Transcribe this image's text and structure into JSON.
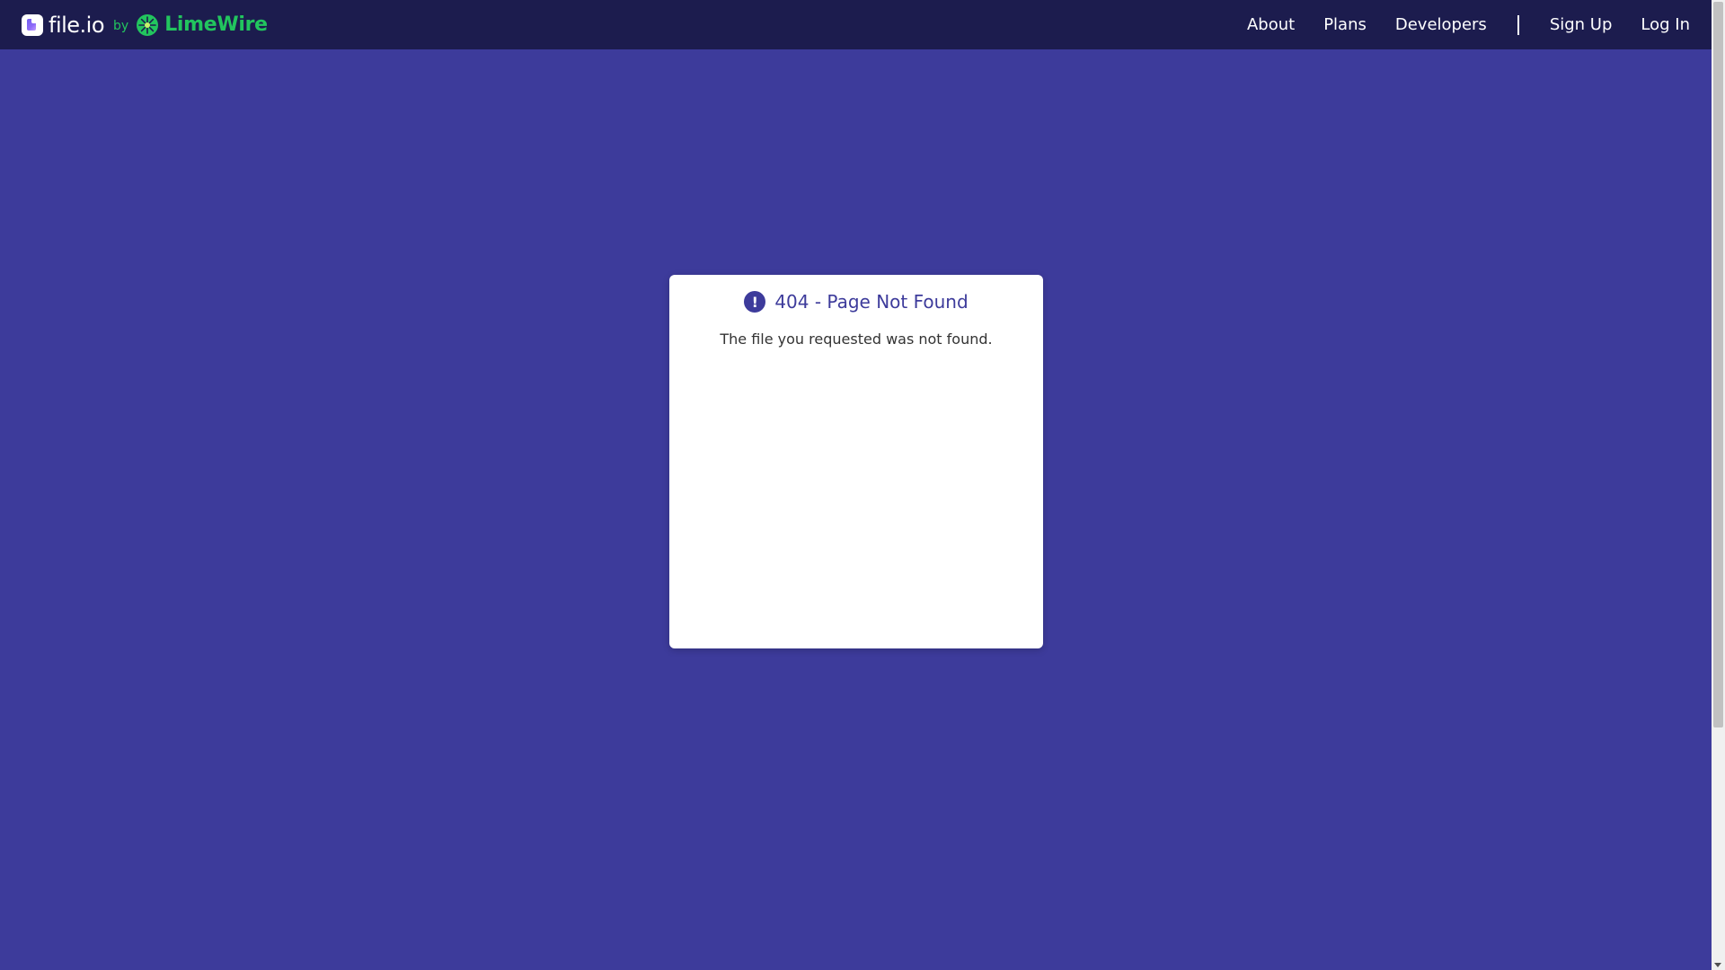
{
  "navbar": {
    "brand_name": "file.io",
    "brand_by": "by",
    "partner_name": "LimeWire",
    "links": [
      {
        "label": "About"
      },
      {
        "label": "Plans"
      },
      {
        "label": "Developers"
      }
    ],
    "auth": [
      {
        "label": "Sign Up"
      },
      {
        "label": "Log In"
      }
    ]
  },
  "error": {
    "icon": "exclamation-circle-icon",
    "icon_glyph": "!",
    "title": "404 - Page Not Found",
    "message": "The file you requested was not found."
  },
  "colors": {
    "navbar_bg": "#1c1c4e",
    "page_bg": "#3d3b9b",
    "limewire_green": "#22c55e"
  }
}
